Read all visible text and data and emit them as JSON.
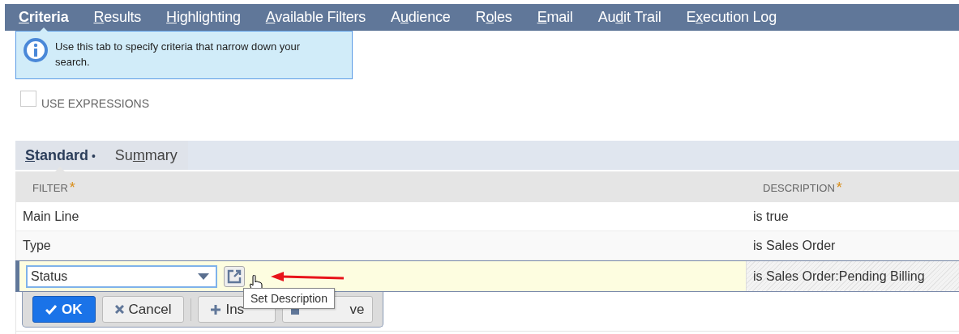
{
  "tabs": [
    {
      "key": "C",
      "after": "riteria",
      "selected": true
    },
    {
      "key": "R",
      "after": "esults",
      "selected": false
    },
    {
      "key": "H",
      "after": "ighlighting",
      "selected": false
    },
    {
      "key": "A",
      "after": "vailable Filters",
      "selected": false
    },
    {
      "before": "A",
      "key": "u",
      "after": "dience",
      "selected": false
    },
    {
      "before": "R",
      "key": "o",
      "after": "les",
      "selected": false
    },
    {
      "key": "E",
      "after": "mail",
      "selected": false
    },
    {
      "before": "Au",
      "key": "d",
      "after": "it Trail",
      "selected": false
    },
    {
      "before": "E",
      "key": "x",
      "after": "ecution Log",
      "selected": false
    }
  ],
  "info": "Use this tab to specify criteria that narrow down your search.",
  "use_expressions": {
    "label": "USE EXPRESSIONS",
    "checked": false
  },
  "subtabs": [
    {
      "key": "S",
      "after": "tandard",
      "marker": "•",
      "selected": true
    },
    {
      "before": "Su",
      "key": "m",
      "after": "mary",
      "selected": false
    }
  ],
  "table": {
    "columns": [
      {
        "label": "FILTER",
        "required": "*"
      },
      {
        "label": "DESCRIPTION",
        "required": "*"
      }
    ],
    "rows": [
      {
        "kind": "row",
        "filter": "Main Line",
        "description": "is true"
      },
      {
        "kind": "row",
        "filter": "Type",
        "description": "is Sales Order"
      },
      {
        "kind": "edit",
        "filter": "Status",
        "description": "is Sales Order:Pending Billing"
      }
    ]
  },
  "buttons": [
    {
      "kind": "primary",
      "label": "OK"
    },
    {
      "kind": "cancel",
      "label": "Cancel"
    },
    {
      "kind": "insert",
      "label": "Ins"
    },
    {
      "kind": "remove",
      "label": "ve"
    }
  ],
  "tooltip": "Set Description"
}
